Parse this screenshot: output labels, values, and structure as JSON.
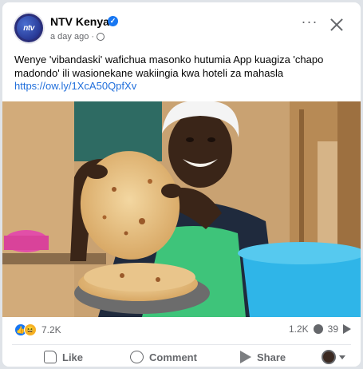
{
  "post": {
    "page_name": "NTV Kenya",
    "avatar_text": "ntv",
    "timestamp": "a day ago",
    "caption": "Wenye 'vibandaski' wafichua masonko hutumia App kuagiza 'chapo madondo' ili wasionekane wakiingia kwa hoteli za mahasla",
    "link": "https://ow.ly/1XcA50QpfXv"
  },
  "stats": {
    "reactions_count": "7.2K",
    "comments_count": "1.2K",
    "shares_count": "39"
  },
  "actions": {
    "like_label": "Like",
    "comment_label": "Comment",
    "share_label": "Share"
  },
  "icons": {
    "verified": "verified-badge-icon",
    "globe": "globe-icon",
    "more": "more-options-icon",
    "close": "close-icon",
    "like_reaction": "like-reaction-icon",
    "haha_reaction": "haha-reaction-icon",
    "like": "thumbs-up-icon",
    "comment": "comment-bubble-icon",
    "share": "share-arrow-icon"
  },
  "colors": {
    "link": "#216fdb",
    "verified": "#1877f2",
    "secondary_text": "#65676b"
  }
}
